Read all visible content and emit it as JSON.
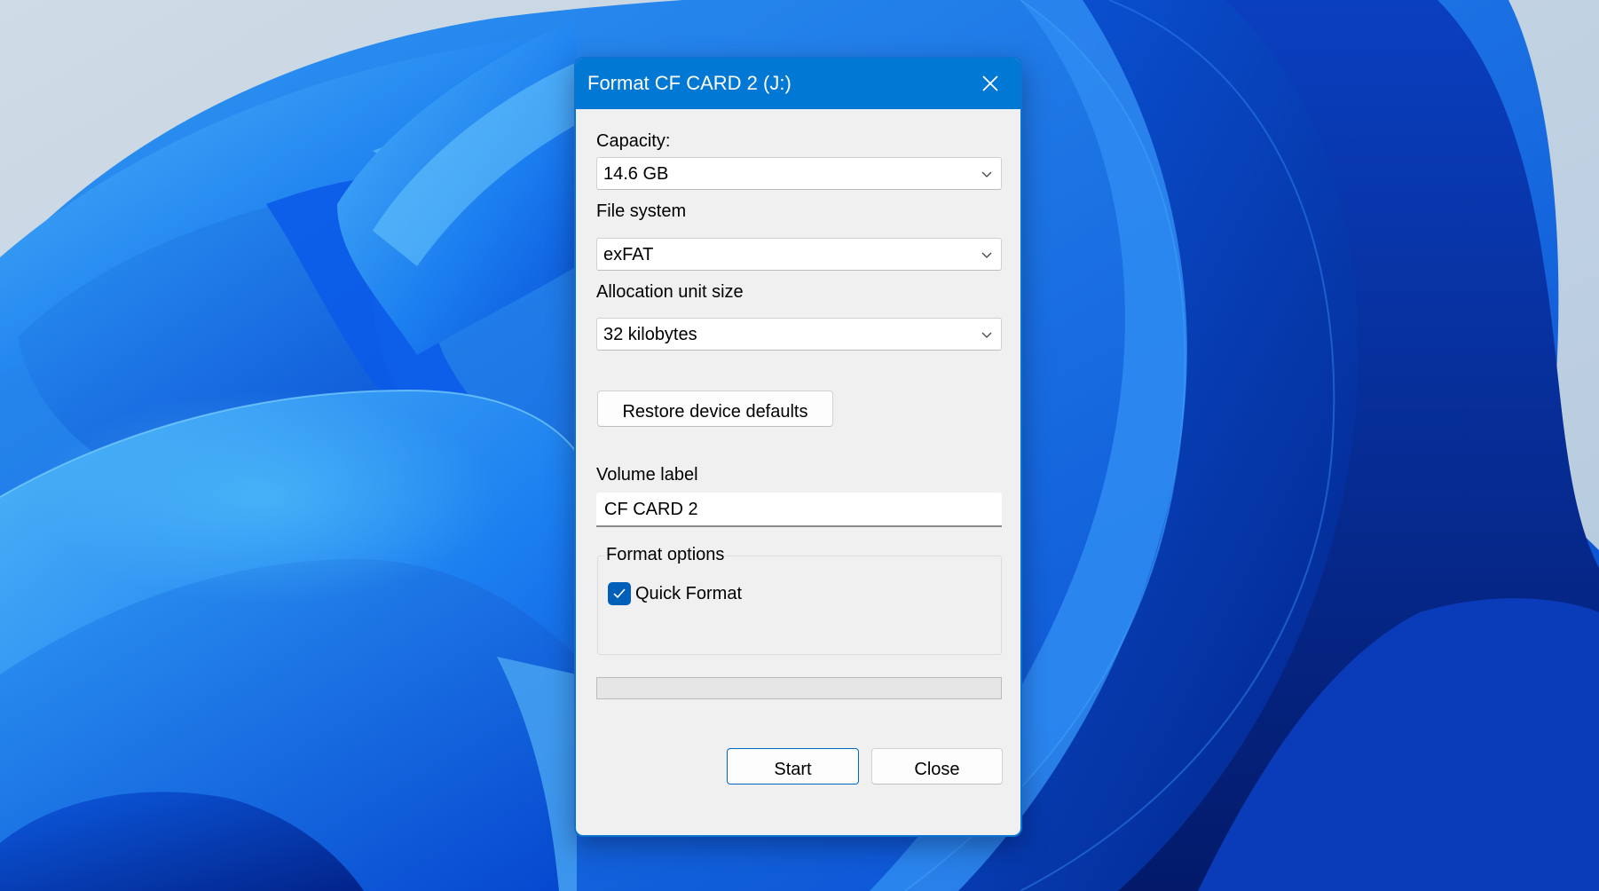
{
  "window": {
    "title": "Format CF CARD 2 (J:)",
    "close_icon": "close-icon",
    "accent_color": "#0078d4"
  },
  "capacity": {
    "label": "Capacity:",
    "value": "14.6 GB"
  },
  "file_system": {
    "label": "File system",
    "value": "exFAT"
  },
  "allocation_unit": {
    "label": "Allocation unit size",
    "value": "32 kilobytes"
  },
  "restore_defaults_label": "Restore device defaults",
  "volume_label": {
    "label": "Volume label",
    "value": "CF CARD 2"
  },
  "format_options": {
    "title": "Format options",
    "quick_format": {
      "label": "Quick Format",
      "checked": true
    }
  },
  "progress": {
    "percent": 0
  },
  "buttons": {
    "start": "Start",
    "close": "Close"
  }
}
